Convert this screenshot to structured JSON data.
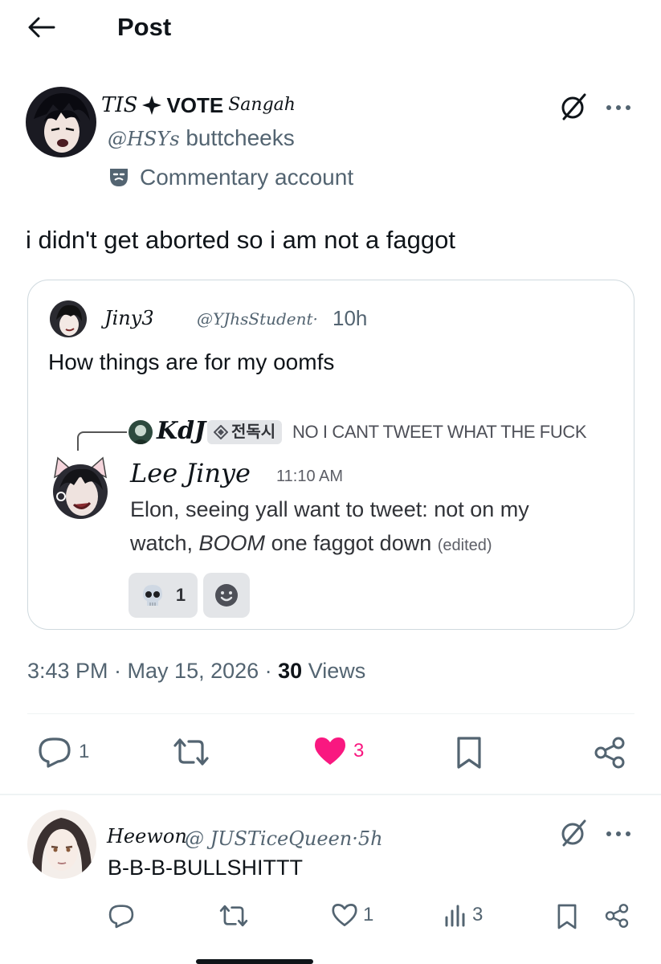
{
  "header": {
    "title": "Post"
  },
  "post": {
    "author_name_part1": "TIS",
    "author_name_part2": "VOTE",
    "author_name_part3": "Sangah",
    "author_handle_prefix": "@HSYs",
    "author_handle_suffix": "buttcheeks",
    "account_label": "Commentary account",
    "text": "i didn't get aborted so i am not a faggot",
    "meta_time": "3:43 PM · May 15, 2026 · ",
    "meta_views_count": "30",
    "meta_views_label": " Views",
    "actions": {
      "reply_count": "1",
      "like_count": "3"
    }
  },
  "quote": {
    "name": "Jiny3",
    "handle": "@YJhsStudent·",
    "time": "10h",
    "text": "How things are for my oomfs",
    "discord": {
      "reply_author": "KdJ",
      "reply_tag": "전독시",
      "reply_text": "NO I CANT TWEET WHAT THE FUCK",
      "author": "Lee Jinye",
      "time": "11:10 AM",
      "line1": "Elon, seeing yall want to tweet: not on my",
      "line2_a": "watch, ",
      "line2_em": "BOOM",
      "line2_b": " one faggot down ",
      "edited": "(edited)",
      "reaction_count": "1"
    }
  },
  "reply_tweet": {
    "name": "Heewon",
    "handle": "@ JUSTiceQueen·5h",
    "text": "B-B-B-BULLSHITTT",
    "like_count": "1",
    "views_count": "3"
  },
  "colors": {
    "like": "#f91880",
    "muted": "#536471",
    "border": "#cfd9de"
  }
}
